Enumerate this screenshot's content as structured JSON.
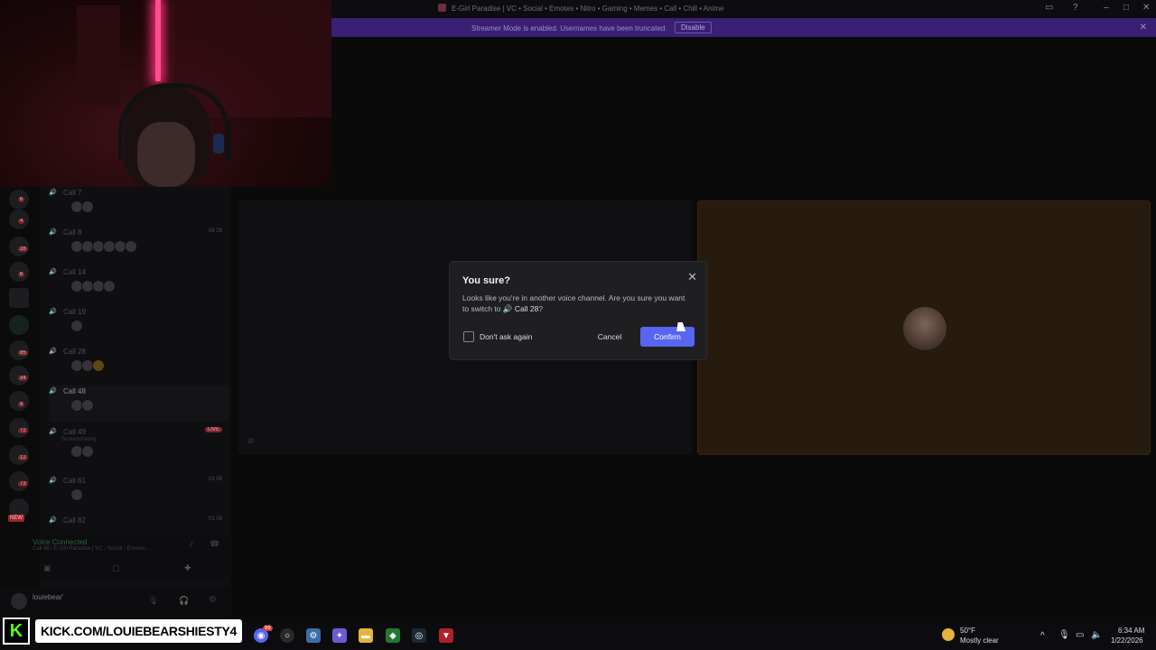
{
  "window": {
    "title": "E-Girl Paradise | VC • Social • Emotes • Nitro • Gaming • Memes • Call • Chill • Anime"
  },
  "streamer_bar": {
    "message": "Streamer Mode is enabled. Usernames have been truncated.",
    "disable_label": "Disable"
  },
  "channels": [
    {
      "label": "Call 7",
      "right": ""
    },
    {
      "label": "Call 8",
      "right": "06  29"
    },
    {
      "label": "Call 14",
      "right": ""
    },
    {
      "label": "Call 19",
      "right": ""
    },
    {
      "label": "Call 28",
      "right": ""
    },
    {
      "label": "Call 48",
      "right": ""
    },
    {
      "label": "Call 49",
      "right": "LIVE",
      "sub": "Screensharing"
    },
    {
      "label": "Call 61",
      "right": "01  06"
    },
    {
      "label": "Call 82",
      "right": "01  09"
    }
  ],
  "voice_panel": {
    "status": "Voice Connected",
    "detail": "Call 48 / E-Girl Paradise | VC - Social - Emotes..."
  },
  "user_panel": {
    "username": "louiebear'"
  },
  "server_badges": [
    "6",
    "4",
    "28",
    "6",
    "85",
    "34",
    "9",
    "72",
    "12",
    "73"
  ],
  "server_new_label": "NEW",
  "modal": {
    "title": "You sure?",
    "body_prefix": "Looks like you're in another voice channel. Are you sure you want to switch to",
    "channel_name": "Call 28",
    "body_suffix": "?",
    "checkbox_label": "Don't ask again",
    "cancel_label": "Cancel",
    "confirm_label": "Confirm"
  },
  "overlay": {
    "kick_logo": "K",
    "kick_text": "KICK.COM/LOUIEBEARSHIESTY4"
  },
  "taskbar": {
    "weather_temp": "50°F",
    "weather_desc": "Mostly clear",
    "time": "6:34 AM",
    "date": "1/22/2026",
    "discord_badge": "99"
  },
  "colors": {
    "accent": "#5865f2",
    "streamer_bar": "#3a1f75",
    "live": "#c32b35",
    "kick_green": "#53fc18"
  }
}
